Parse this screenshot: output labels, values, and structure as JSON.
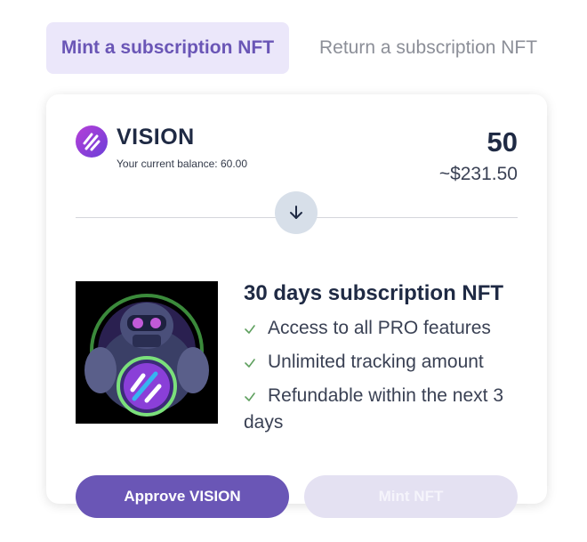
{
  "tabs": {
    "mint_label": "Mint a subscription NFT",
    "return_label": "Return a subscription NFT"
  },
  "token": {
    "name": "VISION",
    "balance_text": "Your current balance: 60.00",
    "amount": "50",
    "fiat_value": "~$231.50",
    "icon": "vision-token-icon"
  },
  "nft": {
    "title": "30 days subscription NFT",
    "features": [
      "Access to all PRO features",
      "Unlimited tracking amount",
      "Refundable within the next 3 days"
    ]
  },
  "actions": {
    "approve_label": "Approve VISION",
    "mint_label": "Mint NFT"
  },
  "colors": {
    "accent": "#6a56b6",
    "tab_active_bg": "#ebe7fa",
    "check_green": "#5fa05f"
  }
}
